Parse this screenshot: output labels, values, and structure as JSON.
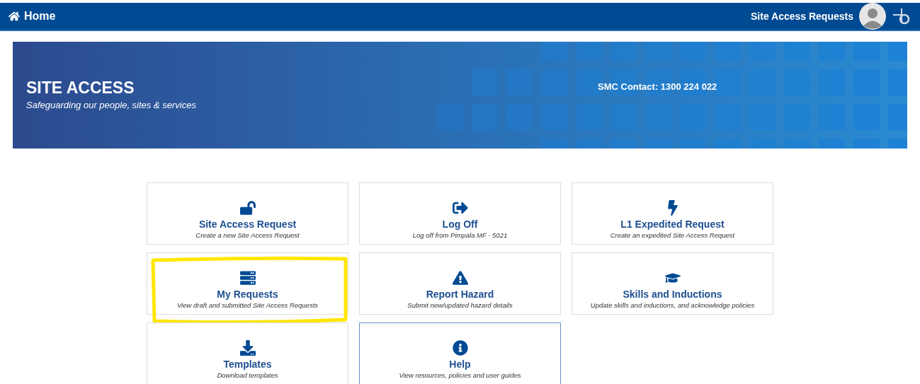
{
  "top_bar": {
    "home_link": "Home",
    "app_title": "Site Access Requests"
  },
  "banner": {
    "title": "SITE ACCESS",
    "tagline": "Safeguarding our people, sites & services",
    "contact": "SMC Contact: 1300 224 022"
  },
  "tiles": [
    {
      "title": "Site Access Request",
      "subtitle": "Create a new Site Access Request",
      "highlighted": false,
      "focused": false
    },
    {
      "title": "Log Off",
      "subtitle": "Log off from Pimpala MF - 5021",
      "highlighted": false,
      "focused": false
    },
    {
      "title": "L1 Expedited Request",
      "subtitle": "Create an expedited Site Access Request",
      "highlighted": false,
      "focused": false
    },
    {
      "title": "My Requests",
      "subtitle": "View draft and submitted Site Access Requests",
      "highlighted": true,
      "focused": false
    },
    {
      "title": "Report Hazard",
      "subtitle": "Submit new/updated hazard details",
      "highlighted": false,
      "focused": false
    },
    {
      "title": "Skills and Inductions",
      "subtitle": "Update skills and inductions, and acknowledge policies",
      "highlighted": false,
      "focused": false
    },
    {
      "title": "Templates",
      "subtitle": "Download templates",
      "highlighted": false,
      "focused": false
    },
    {
      "title": "Help",
      "subtitle": "View resources, policies and user guides",
      "highlighted": false,
      "focused": true
    }
  ]
}
